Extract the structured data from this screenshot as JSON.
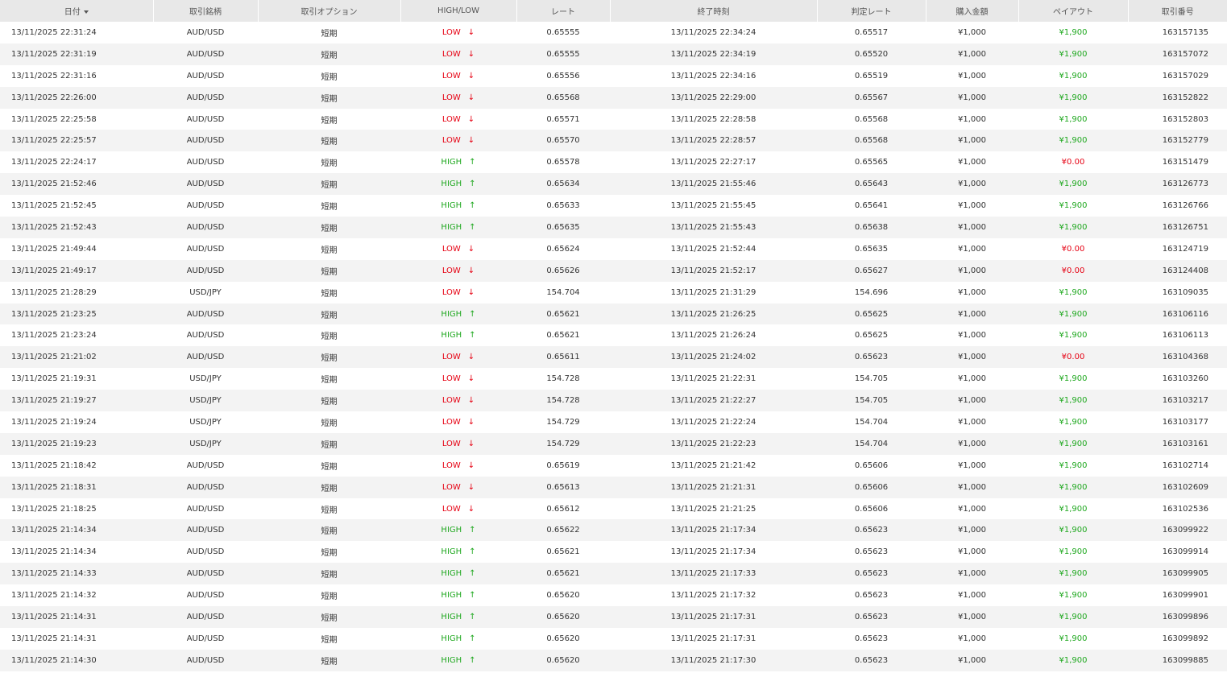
{
  "columns": [
    "日付",
    "取引銘柄",
    "取引オプション",
    "HIGH/LOW",
    "レート",
    "終了時刻",
    "判定レート",
    "購入金額",
    "ペイアウト",
    "取引番号"
  ],
  "sort_column": "日付",
  "colors": {
    "low": "#e60012",
    "high": "#1fa81f",
    "header_bg": "#e8e8e8",
    "stripe_bg": "#f3f3f3"
  },
  "rows": [
    {
      "date": "13/11/2025 22:31:24",
      "pair": "AUD/USD",
      "option": "短期",
      "dir": "LOW",
      "dir_icon": "↓",
      "rate": "0.65555",
      "end": "13/11/2025 22:34:24",
      "judge": "0.65517",
      "amount": "¥1,000",
      "payout": "¥1,900",
      "id": "163157135"
    },
    {
      "date": "13/11/2025 22:31:19",
      "pair": "AUD/USD",
      "option": "短期",
      "dir": "LOW",
      "dir_icon": "↓",
      "rate": "0.65555",
      "end": "13/11/2025 22:34:19",
      "judge": "0.65520",
      "amount": "¥1,000",
      "payout": "¥1,900",
      "id": "163157072"
    },
    {
      "date": "13/11/2025 22:31:16",
      "pair": "AUD/USD",
      "option": "短期",
      "dir": "LOW",
      "dir_icon": "↓",
      "rate": "0.65556",
      "end": "13/11/2025 22:34:16",
      "judge": "0.65519",
      "amount": "¥1,000",
      "payout": "¥1,900",
      "id": "163157029"
    },
    {
      "date": "13/11/2025 22:26:00",
      "pair": "AUD/USD",
      "option": "短期",
      "dir": "LOW",
      "dir_icon": "↓",
      "rate": "0.65568",
      "end": "13/11/2025 22:29:00",
      "judge": "0.65567",
      "amount": "¥1,000",
      "payout": "¥1,900",
      "id": "163152822"
    },
    {
      "date": "13/11/2025 22:25:58",
      "pair": "AUD/USD",
      "option": "短期",
      "dir": "LOW",
      "dir_icon": "↓",
      "rate": "0.65571",
      "end": "13/11/2025 22:28:58",
      "judge": "0.65568",
      "amount": "¥1,000",
      "payout": "¥1,900",
      "id": "163152803"
    },
    {
      "date": "13/11/2025 22:25:57",
      "pair": "AUD/USD",
      "option": "短期",
      "dir": "LOW",
      "dir_icon": "↓",
      "rate": "0.65570",
      "end": "13/11/2025 22:28:57",
      "judge": "0.65568",
      "amount": "¥1,000",
      "payout": "¥1,900",
      "id": "163152779"
    },
    {
      "date": "13/11/2025 22:24:17",
      "pair": "AUD/USD",
      "option": "短期",
      "dir": "HIGH",
      "dir_icon": "↑",
      "rate": "0.65578",
      "end": "13/11/2025 22:27:17",
      "judge": "0.65565",
      "amount": "¥1,000",
      "payout": "¥0.00",
      "id": "163151479"
    },
    {
      "date": "13/11/2025 21:52:46",
      "pair": "AUD/USD",
      "option": "短期",
      "dir": "HIGH",
      "dir_icon": "↑",
      "rate": "0.65634",
      "end": "13/11/2025 21:55:46",
      "judge": "0.65643",
      "amount": "¥1,000",
      "payout": "¥1,900",
      "id": "163126773"
    },
    {
      "date": "13/11/2025 21:52:45",
      "pair": "AUD/USD",
      "option": "短期",
      "dir": "HIGH",
      "dir_icon": "↑",
      "rate": "0.65633",
      "end": "13/11/2025 21:55:45",
      "judge": "0.65641",
      "amount": "¥1,000",
      "payout": "¥1,900",
      "id": "163126766"
    },
    {
      "date": "13/11/2025 21:52:43",
      "pair": "AUD/USD",
      "option": "短期",
      "dir": "HIGH",
      "dir_icon": "↑",
      "rate": "0.65635",
      "end": "13/11/2025 21:55:43",
      "judge": "0.65638",
      "amount": "¥1,000",
      "payout": "¥1,900",
      "id": "163126751"
    },
    {
      "date": "13/11/2025 21:49:44",
      "pair": "AUD/USD",
      "option": "短期",
      "dir": "LOW",
      "dir_icon": "↓",
      "rate": "0.65624",
      "end": "13/11/2025 21:52:44",
      "judge": "0.65635",
      "amount": "¥1,000",
      "payout": "¥0.00",
      "id": "163124719"
    },
    {
      "date": "13/11/2025 21:49:17",
      "pair": "AUD/USD",
      "option": "短期",
      "dir": "LOW",
      "dir_icon": "↓",
      "rate": "0.65626",
      "end": "13/11/2025 21:52:17",
      "judge": "0.65627",
      "amount": "¥1,000",
      "payout": "¥0.00",
      "id": "163124408"
    },
    {
      "date": "13/11/2025 21:28:29",
      "pair": "USD/JPY",
      "option": "短期",
      "dir": "LOW",
      "dir_icon": "↓",
      "rate": "154.704",
      "end": "13/11/2025 21:31:29",
      "judge": "154.696",
      "amount": "¥1,000",
      "payout": "¥1,900",
      "id": "163109035"
    },
    {
      "date": "13/11/2025 21:23:25",
      "pair": "AUD/USD",
      "option": "短期",
      "dir": "HIGH",
      "dir_icon": "↑",
      "rate": "0.65621",
      "end": "13/11/2025 21:26:25",
      "judge": "0.65625",
      "amount": "¥1,000",
      "payout": "¥1,900",
      "id": "163106116"
    },
    {
      "date": "13/11/2025 21:23:24",
      "pair": "AUD/USD",
      "option": "短期",
      "dir": "HIGH",
      "dir_icon": "↑",
      "rate": "0.65621",
      "end": "13/11/2025 21:26:24",
      "judge": "0.65625",
      "amount": "¥1,000",
      "payout": "¥1,900",
      "id": "163106113"
    },
    {
      "date": "13/11/2025 21:21:02",
      "pair": "AUD/USD",
      "option": "短期",
      "dir": "LOW",
      "dir_icon": "↓",
      "rate": "0.65611",
      "end": "13/11/2025 21:24:02",
      "judge": "0.65623",
      "amount": "¥1,000",
      "payout": "¥0.00",
      "id": "163104368"
    },
    {
      "date": "13/11/2025 21:19:31",
      "pair": "USD/JPY",
      "option": "短期",
      "dir": "LOW",
      "dir_icon": "↓",
      "rate": "154.728",
      "end": "13/11/2025 21:22:31",
      "judge": "154.705",
      "amount": "¥1,000",
      "payout": "¥1,900",
      "id": "163103260"
    },
    {
      "date": "13/11/2025 21:19:27",
      "pair": "USD/JPY",
      "option": "短期",
      "dir": "LOW",
      "dir_icon": "↓",
      "rate": "154.728",
      "end": "13/11/2025 21:22:27",
      "judge": "154.705",
      "amount": "¥1,000",
      "payout": "¥1,900",
      "id": "163103217"
    },
    {
      "date": "13/11/2025 21:19:24",
      "pair": "USD/JPY",
      "option": "短期",
      "dir": "LOW",
      "dir_icon": "↓",
      "rate": "154.729",
      "end": "13/11/2025 21:22:24",
      "judge": "154.704",
      "amount": "¥1,000",
      "payout": "¥1,900",
      "id": "163103177"
    },
    {
      "date": "13/11/2025 21:19:23",
      "pair": "USD/JPY",
      "option": "短期",
      "dir": "LOW",
      "dir_icon": "↓",
      "rate": "154.729",
      "end": "13/11/2025 21:22:23",
      "judge": "154.704",
      "amount": "¥1,000",
      "payout": "¥1,900",
      "id": "163103161"
    },
    {
      "date": "13/11/2025 21:18:42",
      "pair": "AUD/USD",
      "option": "短期",
      "dir": "LOW",
      "dir_icon": "↓",
      "rate": "0.65619",
      "end": "13/11/2025 21:21:42",
      "judge": "0.65606",
      "amount": "¥1,000",
      "payout": "¥1,900",
      "id": "163102714"
    },
    {
      "date": "13/11/2025 21:18:31",
      "pair": "AUD/USD",
      "option": "短期",
      "dir": "LOW",
      "dir_icon": "↓",
      "rate": "0.65613",
      "end": "13/11/2025 21:21:31",
      "judge": "0.65606",
      "amount": "¥1,000",
      "payout": "¥1,900",
      "id": "163102609"
    },
    {
      "date": "13/11/2025 21:18:25",
      "pair": "AUD/USD",
      "option": "短期",
      "dir": "LOW",
      "dir_icon": "↓",
      "rate": "0.65612",
      "end": "13/11/2025 21:21:25",
      "judge": "0.65606",
      "amount": "¥1,000",
      "payout": "¥1,900",
      "id": "163102536"
    },
    {
      "date": "13/11/2025 21:14:34",
      "pair": "AUD/USD",
      "option": "短期",
      "dir": "HIGH",
      "dir_icon": "↑",
      "rate": "0.65622",
      "end": "13/11/2025 21:17:34",
      "judge": "0.65623",
      "amount": "¥1,000",
      "payout": "¥1,900",
      "id": "163099922"
    },
    {
      "date": "13/11/2025 21:14:34",
      "pair": "AUD/USD",
      "option": "短期",
      "dir": "HIGH",
      "dir_icon": "↑",
      "rate": "0.65621",
      "end": "13/11/2025 21:17:34",
      "judge": "0.65623",
      "amount": "¥1,000",
      "payout": "¥1,900",
      "id": "163099914"
    },
    {
      "date": "13/11/2025 21:14:33",
      "pair": "AUD/USD",
      "option": "短期",
      "dir": "HIGH",
      "dir_icon": "↑",
      "rate": "0.65621",
      "end": "13/11/2025 21:17:33",
      "judge": "0.65623",
      "amount": "¥1,000",
      "payout": "¥1,900",
      "id": "163099905"
    },
    {
      "date": "13/11/2025 21:14:32",
      "pair": "AUD/USD",
      "option": "短期",
      "dir": "HIGH",
      "dir_icon": "↑",
      "rate": "0.65620",
      "end": "13/11/2025 21:17:32",
      "judge": "0.65623",
      "amount": "¥1,000",
      "payout": "¥1,900",
      "id": "163099901"
    },
    {
      "date": "13/11/2025 21:14:31",
      "pair": "AUD/USD",
      "option": "短期",
      "dir": "HIGH",
      "dir_icon": "↑",
      "rate": "0.65620",
      "end": "13/11/2025 21:17:31",
      "judge": "0.65623",
      "amount": "¥1,000",
      "payout": "¥1,900",
      "id": "163099896"
    },
    {
      "date": "13/11/2025 21:14:31",
      "pair": "AUD/USD",
      "option": "短期",
      "dir": "HIGH",
      "dir_icon": "↑",
      "rate": "0.65620",
      "end": "13/11/2025 21:17:31",
      "judge": "0.65623",
      "amount": "¥1,000",
      "payout": "¥1,900",
      "id": "163099892"
    },
    {
      "date": "13/11/2025 21:14:30",
      "pair": "AUD/USD",
      "option": "短期",
      "dir": "HIGH",
      "dir_icon": "↑",
      "rate": "0.65620",
      "end": "13/11/2025 21:17:30",
      "judge": "0.65623",
      "amount": "¥1,000",
      "payout": "¥1,900",
      "id": "163099885"
    }
  ]
}
